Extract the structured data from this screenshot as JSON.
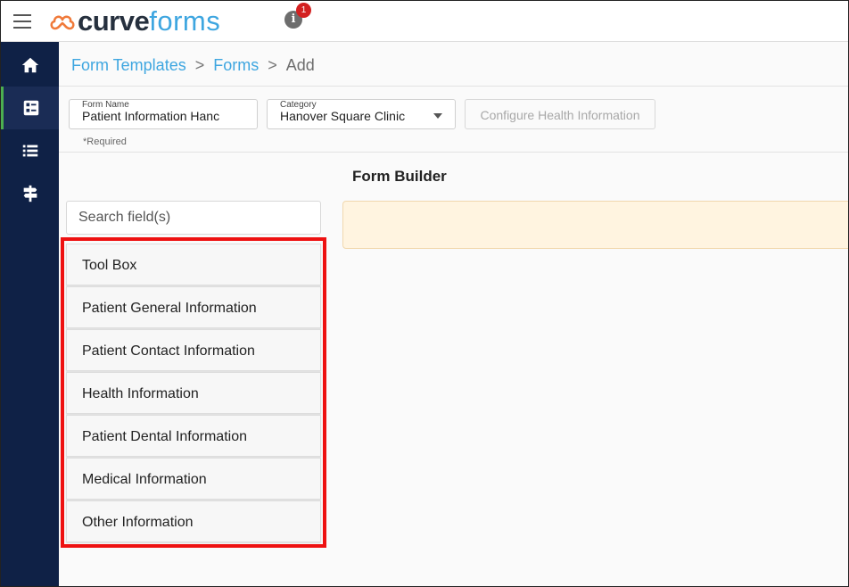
{
  "header": {
    "logo_curve": "curve",
    "logo_forms": "forms",
    "notification_count": "1",
    "info_icon": "i"
  },
  "colors": {
    "brand_blue": "#3ea6e0",
    "sidebar_bg": "#0f2146",
    "active_indicator": "#4caf50",
    "highlight_red": "#ee1111",
    "drop_zone_bg": "#fff4e0"
  },
  "sidebar": {
    "items": [
      {
        "icon": "home-icon",
        "active": false
      },
      {
        "icon": "forms-icon",
        "active": true
      },
      {
        "icon": "list-icon",
        "active": false
      },
      {
        "icon": "signpost-icon",
        "active": false
      }
    ]
  },
  "breadcrumb": {
    "items": [
      "Form Templates",
      "Forms"
    ],
    "current": "Add",
    "separator": ">"
  },
  "form": {
    "name_label": "Form Name",
    "name_value": "Patient Information Hanc",
    "category_label": "Category",
    "category_value": "Hanover Square Clinic",
    "config_button": "Configure Health Information",
    "required_note": "*Required"
  },
  "builder": {
    "title": "Form Builder"
  },
  "search": {
    "placeholder": "Search field(s)",
    "value": ""
  },
  "field_groups": [
    "Tool Box",
    "Patient General Information",
    "Patient Contact Information",
    "Health Information",
    "Patient Dental Information",
    "Medical Information",
    "Other Information"
  ]
}
